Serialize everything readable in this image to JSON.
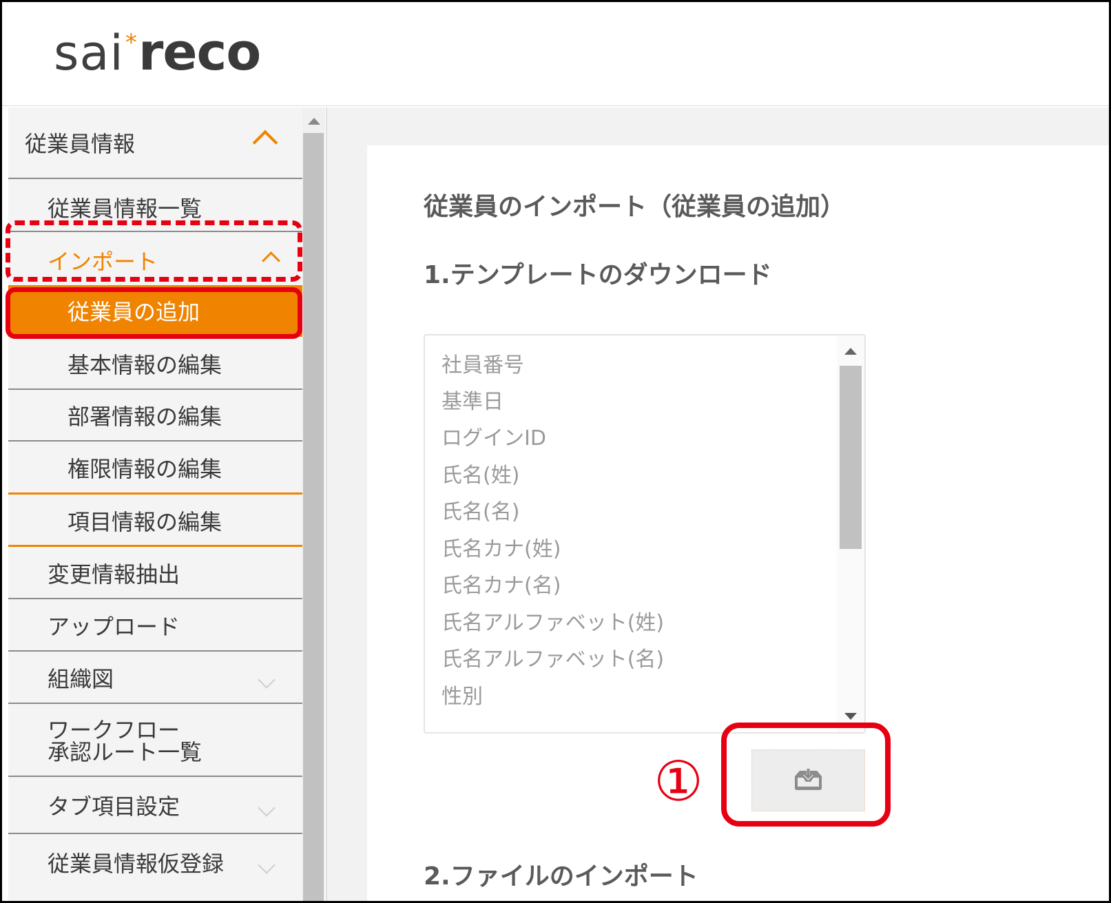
{
  "app": {
    "logo": {
      "part1": "sai",
      "star": "*",
      "part2": "reco"
    }
  },
  "sidebar": {
    "section_employee": "従業員情報",
    "employee_list": "従業員情報一覧",
    "import": "インポート",
    "import_children": [
      "従業員の追加",
      "基本情報の編集",
      "部署情報の編集",
      "権限情報の編集",
      "項目情報の編集"
    ],
    "change_extract": "変更情報抽出",
    "upload": "アップロード",
    "org_chart": "組織図",
    "workflow_line1": "ワークフロー",
    "workflow_line2": "承認ルート一覧",
    "tab_settings": "タブ項目設定",
    "temp_register": "従業員情報仮登録"
  },
  "main": {
    "title": "従業員のインポート（従業員の追加）",
    "step1": "1.テンプレートのダウンロード",
    "fields": [
      "社員番号",
      "基準日",
      "ログインID",
      "氏名(姓)",
      "氏名(名)",
      "氏名カナ(姓)",
      "氏名カナ(名)",
      "氏名アルファベット(姓)",
      "氏名アルファベット(名)",
      "性別"
    ],
    "download_icon": "download-tray-icon",
    "step2": "2.ファイルのインポート"
  },
  "annotation": {
    "marker": "①"
  },
  "colors": {
    "accent": "#f08300",
    "annotation": "#e60012"
  }
}
